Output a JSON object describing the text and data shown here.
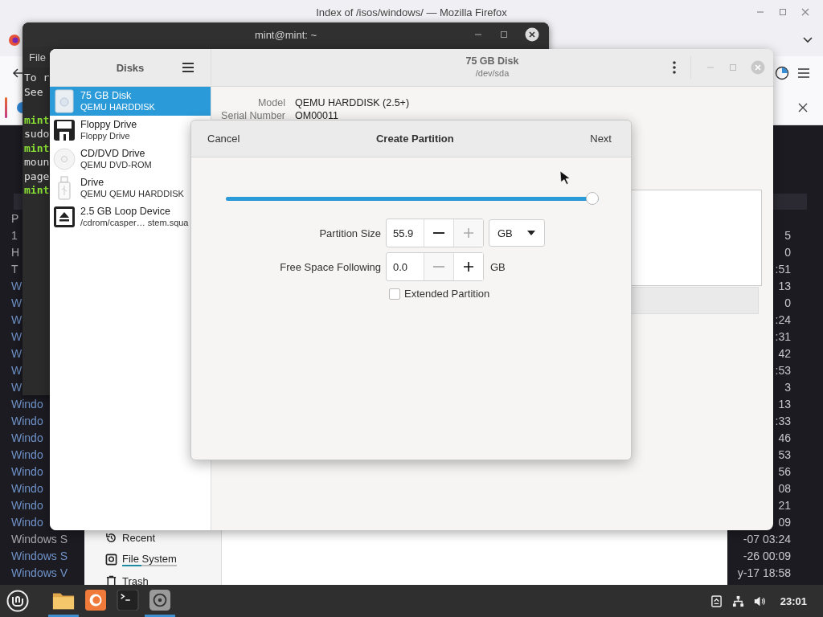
{
  "browser": {
    "title": "Index of /isos/windows/ — Mozilla Firefox",
    "listing": [
      {
        "kind": "text",
        "name": "P"
      },
      {
        "kind": "text",
        "name": "1",
        "date": "5"
      },
      {
        "kind": "text",
        "name": "H",
        "date": "0"
      },
      {
        "kind": "text",
        "name": "T",
        "date": ":51"
      },
      {
        "kind": "link",
        "name": "W",
        "date": "13"
      },
      {
        "kind": "link",
        "name": "W",
        "date": "0"
      },
      {
        "kind": "link",
        "name": "W",
        "date": ":24"
      },
      {
        "kind": "link",
        "name": "W",
        "date": ":31"
      },
      {
        "kind": "link",
        "name": "W",
        "date": "42"
      },
      {
        "kind": "link",
        "name": "W",
        "date": ":53"
      },
      {
        "kind": "link",
        "name": "W",
        "date": "3"
      },
      {
        "kind": "link",
        "name": "Windo",
        "date": "13"
      },
      {
        "kind": "link",
        "name": "Windo",
        "date": ":33"
      },
      {
        "kind": "link",
        "name": "Windo",
        "date": "46"
      },
      {
        "kind": "link",
        "name": "Windo",
        "date": "53"
      },
      {
        "kind": "link",
        "name": "Windo",
        "date": "56"
      },
      {
        "kind": "link",
        "name": "Windo",
        "date": "08"
      },
      {
        "kind": "link",
        "name": "Windo",
        "date": "21"
      },
      {
        "kind": "link",
        "name": "Windo",
        "date": "09"
      },
      {
        "kind": "text",
        "name": "Windows S",
        "date": "-07 03:24"
      },
      {
        "kind": "link",
        "name": "Windows S",
        "date": "-26 00:09"
      },
      {
        "kind": "link",
        "name": "Windows V",
        "date": "y-17 18:58"
      }
    ]
  },
  "terminal": {
    "title": "mint@mint: ~",
    "menu": [
      "File"
    ],
    "lines": [
      {
        "kind": "output",
        "text": "To r"
      },
      {
        "kind": "output",
        "text": "See"
      },
      {
        "kind": "blank"
      },
      {
        "kind": "prompt",
        "text": "mint"
      },
      {
        "kind": "output",
        "text": "sudo"
      },
      {
        "kind": "prompt",
        "text": "mint"
      },
      {
        "kind": "output",
        "text": "moun"
      },
      {
        "kind": "output",
        "text": "page"
      },
      {
        "kind": "prompt",
        "text": "mint"
      }
    ]
  },
  "files": {
    "sidebar": [
      {
        "kind": "recent",
        "label": "Recent"
      },
      {
        "kind": "filesystem",
        "label": "File System",
        "level": 0.35
      },
      {
        "kind": "trash",
        "label": "Trash"
      }
    ]
  },
  "disks": {
    "title": "Disks",
    "devices": [
      {
        "kind": "harddisk",
        "name": "75 GB Disk",
        "detail": "QEMU HARDDISK",
        "selected": true
      },
      {
        "kind": "floppy",
        "name": "Floppy Drive",
        "detail": "Floppy Drive",
        "selected": false
      },
      {
        "kind": "optical",
        "name": "CD/DVD Drive",
        "detail": "QEMU DVD-ROM",
        "selected": false
      },
      {
        "kind": "usb",
        "name": "Drive",
        "detail": "QEMU QEMU HARDDISK",
        "selected": false
      },
      {
        "kind": "loop",
        "name": "2.5 GB Loop Device",
        "detail": "/cdrom/casper… stem.squa",
        "selected": false
      }
    ],
    "header": {
      "title": "75 GB Disk",
      "subtitle": "/dev/sda"
    },
    "info": [
      {
        "label": "Model",
        "value": "QEMU HARDDISK (2.5+)"
      },
      {
        "label": "Serial Number",
        "value": "OM00011"
      }
    ]
  },
  "dialog": {
    "cancel": "Cancel",
    "title": "Create Partition",
    "next": "Next",
    "slider": {
      "level": 1.0
    },
    "rows": [
      {
        "label": "Partition Size",
        "value": "55.9",
        "minus_enabled": true,
        "plus_enabled": false,
        "unit": {
          "kind": "dropdown",
          "text": "GB"
        }
      },
      {
        "label": "Free Space Following",
        "value": "0.0",
        "minus_enabled": false,
        "plus_enabled": true,
        "unit": {
          "kind": "text",
          "text": "GB"
        }
      }
    ],
    "extended": {
      "label": "Extended Partition",
      "checked": false
    }
  },
  "taskbar": {
    "apps": [
      {
        "kind": "files",
        "running": true
      },
      {
        "kind": "firefox",
        "running": false
      },
      {
        "kind": "terminal",
        "running": false
      },
      {
        "kind": "disks",
        "running": true
      }
    ],
    "clock": "23:01"
  }
}
